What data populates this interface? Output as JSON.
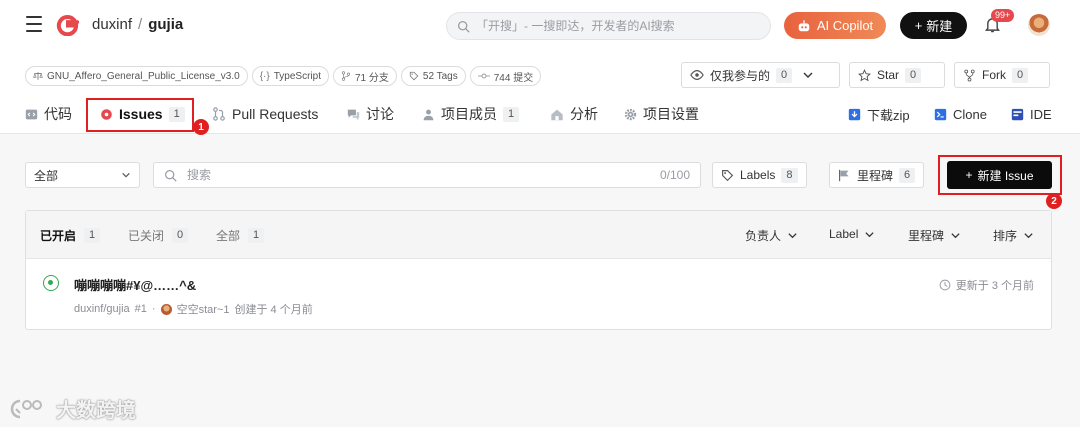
{
  "header": {
    "owner": "duxinf",
    "separator": "/",
    "repo": "gujia",
    "search_placeholder": "「开搜」- 一搜即达，开发者的AI搜索",
    "copilot_label": "AI Copilot",
    "new_label": "新建",
    "notifications_badge": "99+"
  },
  "repo_meta": {
    "tags": [
      {
        "icon": "scale-icon",
        "label": "GNU_Affero_General_Public_License_v3.0"
      },
      {
        "icon": "code-icon",
        "label": "TypeScript"
      },
      {
        "icon": "branch-icon",
        "label": "71 分支"
      },
      {
        "icon": "tag-icon",
        "label": "52 Tags"
      },
      {
        "icon": "commit-icon",
        "label": "744 提交"
      }
    ],
    "watch": {
      "label": "仅我参与的",
      "count": "0"
    },
    "star": {
      "label": "Star",
      "count": "0"
    },
    "fork": {
      "label": "Fork",
      "count": "0"
    }
  },
  "tabs": [
    {
      "label": "代码",
      "icon": "code-icon"
    },
    {
      "label": "Issues",
      "count": "1",
      "icon": "issue-icon",
      "active": true
    },
    {
      "label": "Pull Requests",
      "icon": "pull-request-icon"
    },
    {
      "label": "讨论",
      "icon": "chat-icon"
    },
    {
      "label": "项目成员",
      "count": "1",
      "icon": "people-icon"
    },
    {
      "label": "分析",
      "icon": "chart-icon"
    },
    {
      "label": "项目设置",
      "icon": "gear-icon"
    }
  ],
  "actions": [
    {
      "label": "下载zip",
      "icon": "download-icon"
    },
    {
      "label": "Clone",
      "icon": "terminal-icon"
    },
    {
      "label": "IDE",
      "icon": "ide-icon"
    }
  ],
  "filter": {
    "scope": "全部",
    "search_placeholder": "搜索",
    "search_limit": "0/100",
    "labels": {
      "label": "Labels",
      "count": "8"
    },
    "milestones": {
      "label": "里程碑",
      "count": "6"
    },
    "new_issue_label": "新建 Issue"
  },
  "issue_list": {
    "states": [
      {
        "label": "已开启",
        "count": "1",
        "active": true
      },
      {
        "label": "已关闭",
        "count": "0"
      },
      {
        "label": "全部",
        "count": "1"
      }
    ],
    "sorters": [
      "负责人",
      "Label",
      "里程碑",
      "排序"
    ],
    "items": [
      {
        "title": "嘣嘣嘣嘣#¥@……^&",
        "repo": "duxinf/gujia",
        "number": "#1",
        "dot": "·",
        "author": "空空star~1",
        "created": "创建于 4 个月前",
        "updated": "更新于 3 个月前",
        "state_color": "#34a853"
      }
    ]
  },
  "annotations": [
    "1",
    "2"
  ],
  "watermark": "大数跨境",
  "colors": {
    "accent_red": "#e02020",
    "copilot_orange": "#e8623e",
    "open_green": "#34a853"
  }
}
